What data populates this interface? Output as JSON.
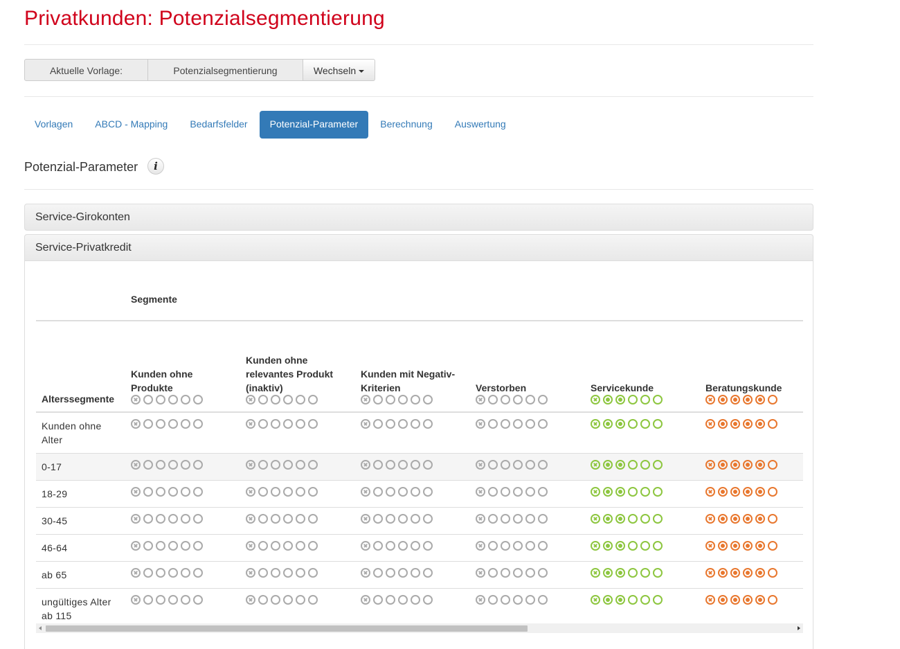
{
  "page_title": "Privatkunden: Potenzialsegmentierung",
  "template": {
    "label": "Aktuelle Vorlage:",
    "value": "Potenzialsegmentierung",
    "switch_label": "Wechseln"
  },
  "tabs": [
    {
      "label": "Vorlagen",
      "active": false
    },
    {
      "label": "ABCD - Mapping",
      "active": false
    },
    {
      "label": "Bedarfsfelder",
      "active": false
    },
    {
      "label": "Potenzial-Parameter",
      "active": true
    },
    {
      "label": "Berechnung",
      "active": false
    },
    {
      "label": "Auswertung",
      "active": false
    }
  ],
  "section_title": "Potenzial-Parameter",
  "info_icon": "info-icon",
  "panels": [
    {
      "title": "Service-Girokonten"
    },
    {
      "title": "Service-Privatkredit"
    }
  ],
  "table": {
    "segments_header": "Segmente",
    "age_header": "Alterssegmente",
    "segments": [
      {
        "label": "Kunden ohne Produkte",
        "color": "grey",
        "dots": [
          "x",
          "o",
          "o",
          "o",
          "o",
          "o"
        ]
      },
      {
        "label": "Kunden ohne relevantes Produkt (inaktiv)",
        "color": "grey",
        "dots": [
          "x",
          "o",
          "o",
          "o",
          "o",
          "o"
        ]
      },
      {
        "label": "Kunden mit Negativ-Kriterien",
        "color": "grey",
        "dots": [
          "x",
          "o",
          "o",
          "o",
          "o",
          "o"
        ]
      },
      {
        "label": "Verstorben",
        "color": "grey",
        "dots": [
          "x",
          "o",
          "o",
          "o",
          "o",
          "o"
        ]
      },
      {
        "label": "Servicekunde",
        "color": "green",
        "dots": [
          "x",
          "f",
          "f",
          "o",
          "o",
          "o"
        ]
      },
      {
        "label": "Beratungskunde",
        "color": "orange",
        "dots": [
          "x",
          "f",
          "f",
          "f",
          "f",
          "o"
        ]
      }
    ],
    "rows": [
      {
        "label": "Kunden ohne Alter"
      },
      {
        "label": "0-17"
      },
      {
        "label": "18-29"
      },
      {
        "label": "30-45"
      },
      {
        "label": "46-64"
      },
      {
        "label": "ab 65"
      },
      {
        "label": "ungültiges Alter ab 115"
      }
    ]
  },
  "colors": {
    "grey": "#aaaaaa",
    "green": "#8dc63f",
    "orange": "#e8772e",
    "title_red": "#d0021b",
    "accent": "#337ab7"
  }
}
